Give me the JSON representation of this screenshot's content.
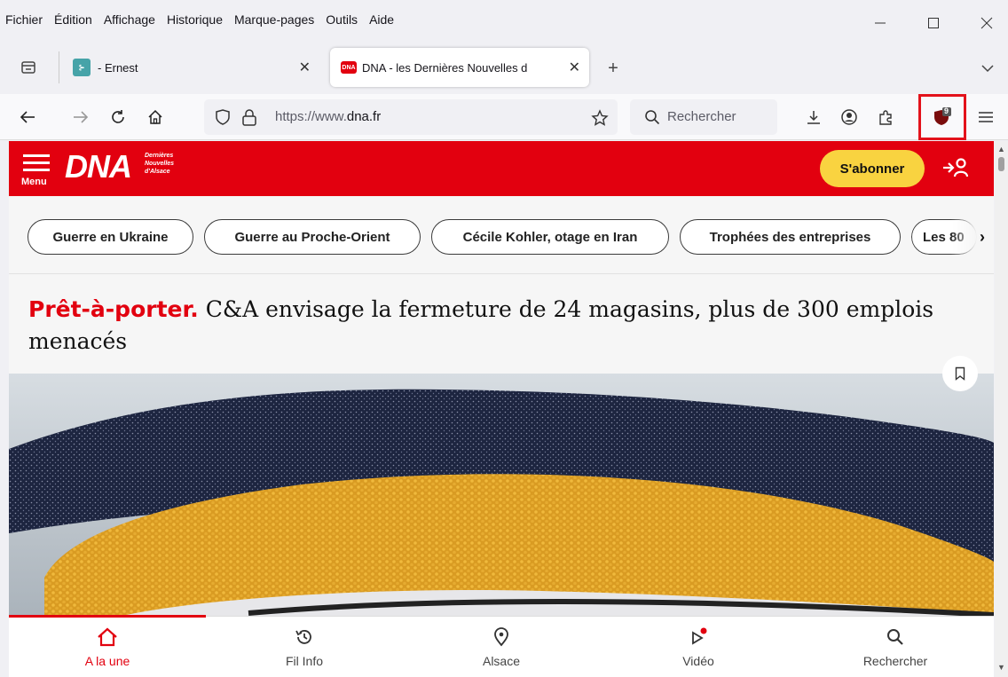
{
  "menubar": {
    "items": [
      "Fichier",
      "Édition",
      "Affichage",
      "Historique",
      "Marque-pages",
      "Outils",
      "Aide"
    ],
    "window_controls": [
      "minimize-icon",
      "maximize-icon",
      "close-icon"
    ]
  },
  "tabs": [
    {
      "title": "- Ernest",
      "favicon": "ernest-favicon",
      "active": false
    },
    {
      "title": "DNA - les Dernières Nouvelles d",
      "favicon": "DNA",
      "active": true
    }
  ],
  "navbar": {
    "url_prefix": "https://www.",
    "url_domain": "dna.fr",
    "search_placeholder": "Rechercher",
    "extension_badge": "9"
  },
  "site": {
    "logo": "DNA",
    "logo_sub": [
      "Dernières",
      "Nouvelles",
      "d'Alsace"
    ],
    "menu_label": "Menu",
    "subscribe_label": "S'abonner",
    "brand_color": "#e2000f"
  },
  "topics": [
    "Guerre en Ukraine",
    "Guerre au Proche-Orient",
    "Cécile Kohler, otage en Iran",
    "Trophées des entreprises",
    "Les 80"
  ],
  "article": {
    "kicker": "Prêt-à-porter.",
    "title": " C&A envisage la fermeture de 24 magasins, plus de 300 emplois menacés"
  },
  "bottom_nav": [
    {
      "label": "A la une",
      "icon": "home-icon",
      "active": true
    },
    {
      "label": "Fil Info",
      "icon": "history-icon",
      "active": false
    },
    {
      "label": "Alsace",
      "icon": "location-pin-icon",
      "active": false
    },
    {
      "label": "Vidéo",
      "icon": "play-icon",
      "active": false
    },
    {
      "label": "Rechercher",
      "icon": "search-icon",
      "active": false
    }
  ]
}
